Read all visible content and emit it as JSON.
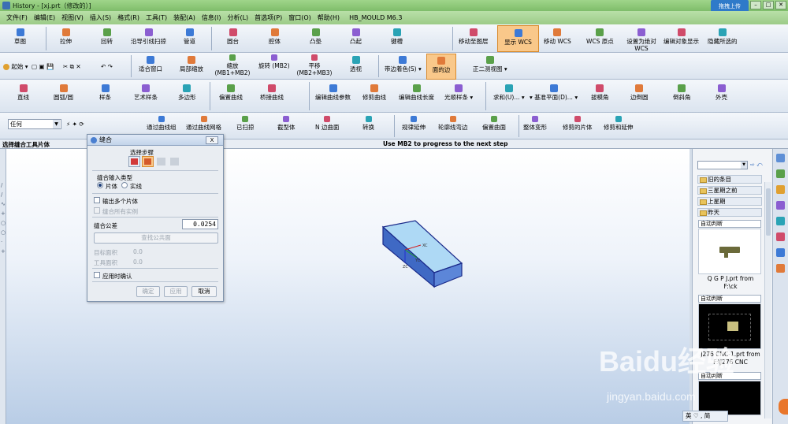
{
  "window": {
    "title": "History - [xj.prt（修改的）]"
  },
  "baidu_btn": "拖拽上传",
  "menu": [
    "文件(F)",
    "编辑(E)",
    "视图(V)",
    "插入(S)",
    "格式(R)",
    "工具(T)",
    "装配(A)",
    "信息(I)",
    "分析(L)",
    "首选项(P)",
    "窗口(O)",
    "帮助(H)"
  ],
  "menu_extra": "HB_MOULD M6.3",
  "row1": [
    "草图",
    "拉伸",
    "回转",
    "沿导引线扫掠",
    "管道",
    "圆台",
    "腔体",
    "凸垫",
    "凸起",
    "键槽",
    "移动至图层",
    "显示 WCS",
    "移动 WCS",
    "WCS 原点",
    "设置为绝对WCS",
    "编辑对象显示",
    "隐藏所选的"
  ],
  "row2": {
    "start": "起始",
    "items": [
      "适合窗口",
      "局部缩放",
      "缩放 (MB1+MB2)",
      "旋转 (MB2)",
      "平移 (MB2+MB3)",
      "透视",
      "带边着色(S)",
      "面的边",
      "正二测视图"
    ]
  },
  "row3": [
    "直线",
    "圆弧/圆",
    "样条",
    "艺术样条",
    "多边形",
    "偏置曲线",
    "桥接曲线",
    "编辑曲线参数",
    "修剪曲线",
    "编辑曲线长度",
    "光顺样条",
    "求和(U)...",
    "基准平面(D)...",
    "拔模角",
    "边倒圆",
    "倒斜角",
    "外壳"
  ],
  "row4": {
    "filter": "任何",
    "items": [
      "通过曲线组",
      "通过曲线网格",
      "已扫掠",
      "截型体",
      "N 边曲面",
      "转换",
      "规律延伸",
      "轮廓线弯边",
      "偏置曲面",
      "整体变形",
      "修剪的片体",
      "修剪和延伸"
    ]
  },
  "status": {
    "left": "选择缝合工具片体",
    "center": "Use MB2 to progress to the next step"
  },
  "dialog": {
    "title": "缝合",
    "close": "X",
    "step_label": "选择步骤",
    "input_type_label": "缝合输入类型",
    "radio_sheet": "片体",
    "radio_solid": "实线",
    "chk_output_multi": "输出多个片体",
    "chk_all_instances": "缝合所有实例",
    "tol_label": "缝合公差",
    "tol_value": "0.0254",
    "find_common": "查找公共面",
    "target_area_label": "目标面积",
    "target_area_value": "0.0",
    "tool_area_label": "工具面积",
    "tool_area_value": "0.0",
    "confirm_label": "应用时确认",
    "ok": "确定",
    "apply": "应用",
    "cancel": "取消"
  },
  "history": {
    "folders": [
      "旧的条目",
      "三星期之前",
      "上星期",
      "昨天"
    ],
    "thumbs": [
      {
        "mode": "自动判断",
        "caption": "Q G P J.prt from F:\\ck"
      },
      {
        "mode": "自动判断",
        "caption": "J276 CNC-1.prt from F:\\J276 CNC"
      },
      {
        "mode": "自动判断",
        "caption": ""
      }
    ]
  },
  "model_labels": {
    "x": "XC",
    "y": "YC",
    "z": "ZC"
  },
  "watermark": {
    "brand": "Baidu经验",
    "url": "jingyan.baidu.com"
  },
  "ime": "英 ♡ , 简"
}
